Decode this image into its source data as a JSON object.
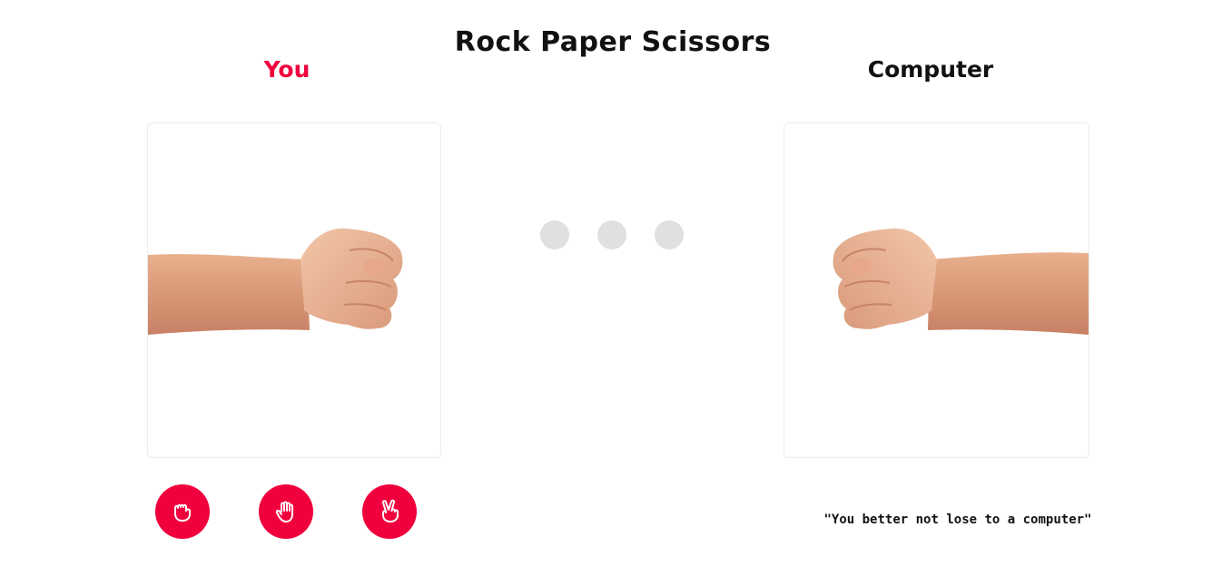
{
  "game": {
    "title": "Rock Paper Scissors",
    "accent_color": "#f0003c",
    "text_color": "#111111"
  },
  "player": {
    "label": "You",
    "current_hand": "rock",
    "hand_image": "fist-pointing-right"
  },
  "computer": {
    "label": "Computer",
    "current_hand": "rock",
    "hand_image": "fist-pointing-left",
    "quote": "\"You better not lose to a computer\""
  },
  "status": {
    "indicator": "waiting-dots",
    "dot_color": "#e0e0e0",
    "dots": 3
  },
  "moves": [
    {
      "name": "rock",
      "icon": "fist-icon"
    },
    {
      "name": "paper",
      "icon": "open-hand-icon"
    },
    {
      "name": "scissors",
      "icon": "peace-hand-icon"
    }
  ]
}
